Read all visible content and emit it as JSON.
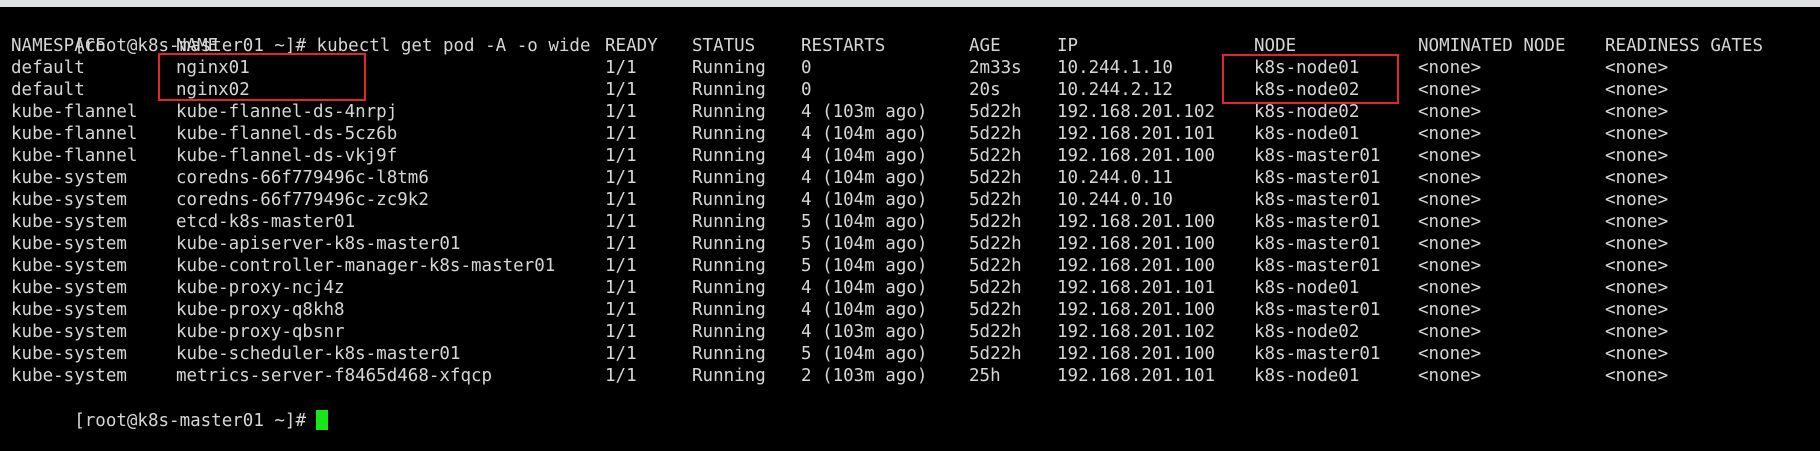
{
  "window": {
    "topbar_color": "#dfe1e4",
    "background_color": "#000000",
    "text_color": "#d6d6d6",
    "cursor_color": "#19e619",
    "highlight_color": "#e3262b"
  },
  "terminal": {
    "command_line": "[root@k8s-master01 ~]# kubectl get pod -A -o wide",
    "prompt_line": "[root@k8s-master01 ~]#",
    "headers": {
      "namespace": "NAMESPACE",
      "name": "NAME",
      "ready": "READY",
      "status": "STATUS",
      "restarts": "RESTARTS",
      "age": "AGE",
      "ip": "IP",
      "node": "NODE",
      "nominated": "NOMINATED NODE",
      "readiness": "READINESS GATES"
    },
    "rows": [
      {
        "namespace": "default",
        "name": "nginx01",
        "ready": "1/1",
        "status": "Running",
        "restarts": "0",
        "age": "2m33s",
        "ip": "10.244.1.10",
        "node": "k8s-node01",
        "nominated": "<none>",
        "readiness": "<none>"
      },
      {
        "namespace": "default",
        "name": "nginx02",
        "ready": "1/1",
        "status": "Running",
        "restarts": "0",
        "age": "20s",
        "ip": "10.244.2.12",
        "node": "k8s-node02",
        "nominated": "<none>",
        "readiness": "<none>"
      },
      {
        "namespace": "kube-flannel",
        "name": "kube-flannel-ds-4nrpj",
        "ready": "1/1",
        "status": "Running",
        "restarts": "4 (103m ago)",
        "age": "5d22h",
        "ip": "192.168.201.102",
        "node": "k8s-node02",
        "nominated": "<none>",
        "readiness": "<none>"
      },
      {
        "namespace": "kube-flannel",
        "name": "kube-flannel-ds-5cz6b",
        "ready": "1/1",
        "status": "Running",
        "restarts": "4 (104m ago)",
        "age": "5d22h",
        "ip": "192.168.201.101",
        "node": "k8s-node01",
        "nominated": "<none>",
        "readiness": "<none>"
      },
      {
        "namespace": "kube-flannel",
        "name": "kube-flannel-ds-vkj9f",
        "ready": "1/1",
        "status": "Running",
        "restarts": "4 (104m ago)",
        "age": "5d22h",
        "ip": "192.168.201.100",
        "node": "k8s-master01",
        "nominated": "<none>",
        "readiness": "<none>"
      },
      {
        "namespace": "kube-system",
        "name": "coredns-66f779496c-l8tm6",
        "ready": "1/1",
        "status": "Running",
        "restarts": "4 (104m ago)",
        "age": "5d22h",
        "ip": "10.244.0.11",
        "node": "k8s-master01",
        "nominated": "<none>",
        "readiness": "<none>"
      },
      {
        "namespace": "kube-system",
        "name": "coredns-66f779496c-zc9k2",
        "ready": "1/1",
        "status": "Running",
        "restarts": "4 (104m ago)",
        "age": "5d22h",
        "ip": "10.244.0.10",
        "node": "k8s-master01",
        "nominated": "<none>",
        "readiness": "<none>"
      },
      {
        "namespace": "kube-system",
        "name": "etcd-k8s-master01",
        "ready": "1/1",
        "status": "Running",
        "restarts": "5 (104m ago)",
        "age": "5d22h",
        "ip": "192.168.201.100",
        "node": "k8s-master01",
        "nominated": "<none>",
        "readiness": "<none>"
      },
      {
        "namespace": "kube-system",
        "name": "kube-apiserver-k8s-master01",
        "ready": "1/1",
        "status": "Running",
        "restarts": "5 (104m ago)",
        "age": "5d22h",
        "ip": "192.168.201.100",
        "node": "k8s-master01",
        "nominated": "<none>",
        "readiness": "<none>"
      },
      {
        "namespace": "kube-system",
        "name": "kube-controller-manager-k8s-master01",
        "ready": "1/1",
        "status": "Running",
        "restarts": "5 (104m ago)",
        "age": "5d22h",
        "ip": "192.168.201.100",
        "node": "k8s-master01",
        "nominated": "<none>",
        "readiness": "<none>"
      },
      {
        "namespace": "kube-system",
        "name": "kube-proxy-ncj4z",
        "ready": "1/1",
        "status": "Running",
        "restarts": "4 (104m ago)",
        "age": "5d22h",
        "ip": "192.168.201.101",
        "node": "k8s-node01",
        "nominated": "<none>",
        "readiness": "<none>"
      },
      {
        "namespace": "kube-system",
        "name": "kube-proxy-q8kh8",
        "ready": "1/1",
        "status": "Running",
        "restarts": "4 (104m ago)",
        "age": "5d22h",
        "ip": "192.168.201.100",
        "node": "k8s-master01",
        "nominated": "<none>",
        "readiness": "<none>"
      },
      {
        "namespace": "kube-system",
        "name": "kube-proxy-qbsnr",
        "ready": "1/1",
        "status": "Running",
        "restarts": "4 (103m ago)",
        "age": "5d22h",
        "ip": "192.168.201.102",
        "node": "k8s-node02",
        "nominated": "<none>",
        "readiness": "<none>"
      },
      {
        "namespace": "kube-system",
        "name": "kube-scheduler-k8s-master01",
        "ready": "1/1",
        "status": "Running",
        "restarts": "5 (104m ago)",
        "age": "5d22h",
        "ip": "192.168.201.100",
        "node": "k8s-master01",
        "nominated": "<none>",
        "readiness": "<none>"
      },
      {
        "namespace": "kube-system",
        "name": "metrics-server-f8465d468-xfqcp",
        "ready": "1/1",
        "status": "Running",
        "restarts": "2 (103m ago)",
        "age": "25h",
        "ip": "192.168.201.101",
        "node": "k8s-node01",
        "nominated": "<none>",
        "readiness": "<none>"
      }
    ]
  }
}
